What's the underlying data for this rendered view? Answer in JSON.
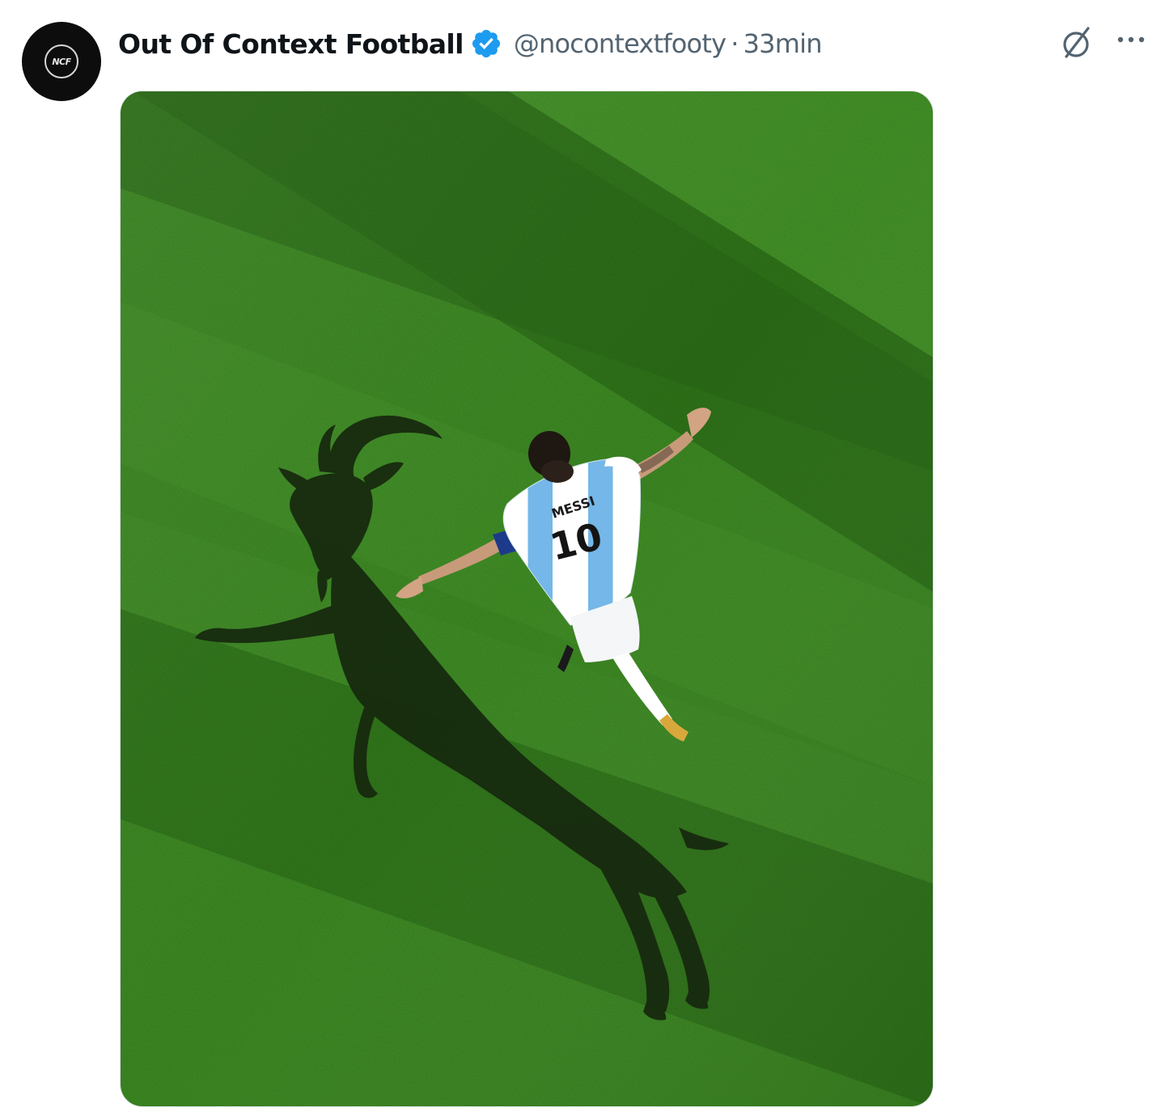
{
  "tweet": {
    "author": {
      "display_name": "Out Of Context Football",
      "handle": "@nocontextfooty",
      "avatar_text": "NCF",
      "verified": true,
      "verified_color": "#1d9bf0"
    },
    "separator": "·",
    "time_ago": "33min",
    "actions": {
      "grok_icon": "grok-icon",
      "more_icon": "more-horizontal-icon"
    },
    "media": {
      "jersey_name": "MESSI",
      "jersey_number": "10",
      "grass_color": "#3c8a22",
      "shadow_color": "#14240d"
    }
  }
}
